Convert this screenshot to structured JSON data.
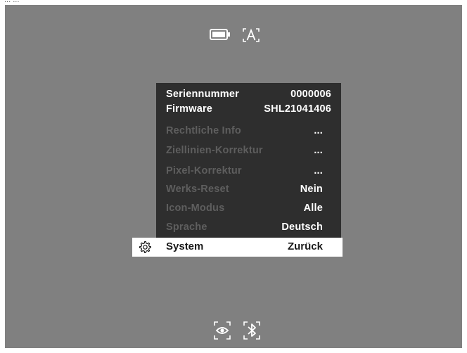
{
  "caption": "... ...",
  "status_top": {
    "icons": [
      "battery-icon",
      "auto-brightness-icon"
    ]
  },
  "status_bottom": {
    "icons": [
      "eye-view-icon",
      "bluetooth-icon"
    ]
  },
  "menu": {
    "serial": {
      "label": "Seriennummer",
      "value": "0000006"
    },
    "firmware": {
      "label": "Firmware",
      "value": "SHL21041406"
    },
    "items": [
      {
        "label": "Rechtliche Info",
        "value": "..."
      },
      {
        "label": "Ziellinien-Korrektur",
        "value": "..."
      },
      {
        "label": "Pixel-Korrektur",
        "value": "..."
      },
      {
        "label": "Werks-Reset",
        "value": "Nein"
      },
      {
        "label": "Icon-Modus",
        "value": "Alle"
      },
      {
        "label": "Sprache",
        "value": "Deutsch"
      }
    ]
  },
  "selected": {
    "icon": "gear-icon",
    "label": "System",
    "value": "Zurück"
  },
  "colors": {
    "screen_bg": "#808080",
    "menu_bg": "#2e2e2e",
    "selected_bg": "#ffffff",
    "dim_label": "#5e5e5e"
  }
}
